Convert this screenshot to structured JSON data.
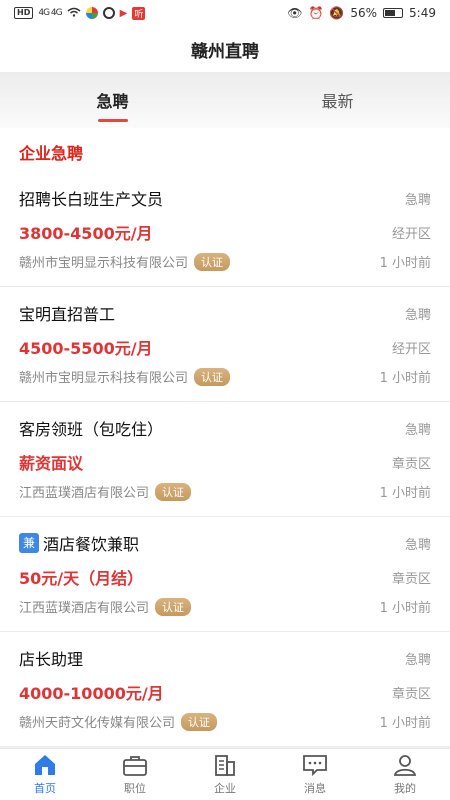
{
  "status": {
    "hd": "HD",
    "signal": "4G 4G",
    "battery": "56%",
    "time": "5:49"
  },
  "header": {
    "title": "赣州直聘"
  },
  "tabs": [
    {
      "label": "急聘"
    },
    {
      "label": "最新"
    }
  ],
  "section": {
    "title": "企业急聘"
  },
  "jobs": [
    {
      "title": "招聘长白班生产文员",
      "tag": "",
      "urgent": "急聘",
      "salary": "3800-4500元/月",
      "area": "经开区",
      "company": "赣州市宝明显示科技有限公司",
      "verified": "认证",
      "time": "1 小时前"
    },
    {
      "title": "宝明直招普工",
      "tag": "",
      "urgent": "急聘",
      "salary": "4500-5500元/月",
      "area": "经开区",
      "company": "赣州市宝明显示科技有限公司",
      "verified": "认证",
      "time": "1 小时前"
    },
    {
      "title": "客房领班（包吃住）",
      "tag": "",
      "urgent": "急聘",
      "salary": "薪资面议",
      "area": "章贡区",
      "company": "江西蓝璞酒店有限公司",
      "verified": "认证",
      "time": "1 小时前"
    },
    {
      "title": "酒店餐饮兼职",
      "tag": "兼",
      "urgent": "急聘",
      "salary": "50元/天（月结）",
      "area": "章贡区",
      "company": "江西蓝璞酒店有限公司",
      "verified": "认证",
      "time": "1 小时前"
    },
    {
      "title": "店长助理",
      "tag": "",
      "urgent": "急聘",
      "salary": "4000-10000元/月",
      "area": "章贡区",
      "company": "赣州天莳文化传媒有限公司",
      "verified": "认证",
      "time": "1 小时前"
    }
  ],
  "nav": [
    {
      "label": "首页",
      "icon": "home-icon"
    },
    {
      "label": "职位",
      "icon": "briefcase-icon"
    },
    {
      "label": "企业",
      "icon": "building-icon"
    },
    {
      "label": "消息",
      "icon": "message-icon"
    },
    {
      "label": "我的",
      "icon": "user-icon"
    }
  ],
  "colors": {
    "accent": "#e2231a",
    "nav_active": "#2f7be8",
    "verified": "#c49a5e"
  }
}
